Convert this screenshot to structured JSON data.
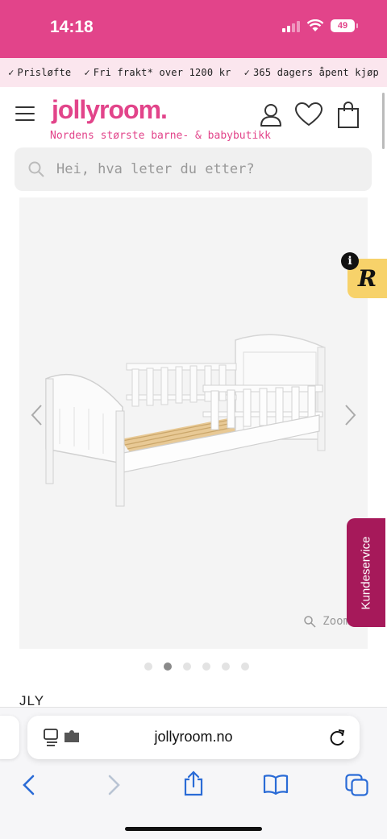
{
  "status_bar": {
    "time": "14:18",
    "battery": "49"
  },
  "usp_bar": {
    "items": [
      "Prisløfte",
      "Fri frakt* over 1200 kr",
      "365 dagers åpent kjøp"
    ]
  },
  "header": {
    "logo": "jollyroom.",
    "tagline": "Nordens største barne- & babybutikk"
  },
  "search": {
    "placeholder": "Hei, hva leter du etter?"
  },
  "gallery": {
    "zoom_label": "Zoom",
    "active_image_index": 2,
    "image_count": 6
  },
  "reviews_badge": {
    "letter": "R",
    "info": "i"
  },
  "kundeservice": {
    "label": "Kundeservice"
  },
  "product": {
    "brand_partial": "JLY"
  },
  "browser": {
    "url": "jollyroom.no"
  },
  "colors": {
    "brand": "#e2448a",
    "kundeservice": "#a6195a",
    "reviews": "#f7d26a"
  }
}
